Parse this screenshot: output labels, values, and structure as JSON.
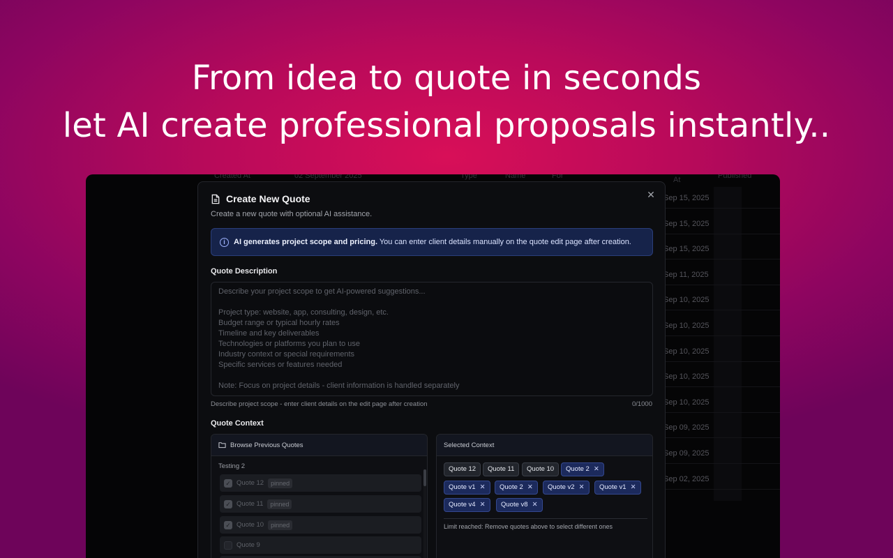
{
  "hero": {
    "line1": "From idea to quote in seconds",
    "line2": "let AI create professional proposals instantly.."
  },
  "background_table": {
    "headers": {
      "created_at": "Created At",
      "created_value": "02 September 2025",
      "type": "Type",
      "name": "Name",
      "for": "For",
      "at": "At",
      "published": "Published"
    },
    "dates": [
      "Sep 15, 2025",
      "Sep 15, 2025",
      "Sep 15, 2025",
      "Sep 11, 2025",
      "Sep 10, 2025",
      "Sep 10, 2025",
      "Sep 10, 2025",
      "Sep 10, 2025",
      "Sep 10, 2025",
      "Sep 09, 2025",
      "Sep 09, 2025",
      "Sep 02, 2025"
    ]
  },
  "modal": {
    "close": "✕",
    "title": "Create New Quote",
    "subtitle": "Create a new quote with optional AI assistance.",
    "info": {
      "icon": "i",
      "strong": "AI generates project scope and pricing.",
      "text": "You can enter client details manually on the quote edit page after creation."
    },
    "description": {
      "label": "Quote Description",
      "placeholder": "Describe your project scope to get AI-powered suggestions...\n\nProject type: website, app, consulting, design, etc.\nBudget range or typical hourly rates\nTimeline and key deliverables\nTechnologies or platforms you plan to use\nIndustry context or special requirements\nSpecific services or features needed\n\nNote: Focus on project details - client information is handled separately",
      "helper": "Describe project scope - enter client details on the edit page after creation",
      "counter": "0/1000"
    },
    "context": {
      "label": "Quote Context",
      "browse_title": "Browse Previous Quotes",
      "group": "Testing 2",
      "items": [
        {
          "name": "Quote 12",
          "tag": "pinned",
          "checked": "✓"
        },
        {
          "name": "Quote 11",
          "tag": "pinned",
          "checked": "✓"
        },
        {
          "name": "Quote 10",
          "tag": "pinned",
          "checked": "✓"
        },
        {
          "name": "Quote 9",
          "tag": "",
          "checked": ""
        }
      ],
      "selected_title": "Selected Context",
      "chips": [
        {
          "label": "Quote 12",
          "x": ""
        },
        {
          "label": "Quote 11",
          "x": ""
        },
        {
          "label": "Quote 10",
          "x": ""
        },
        {
          "label": "Quote 2",
          "x": "✕"
        },
        {
          "label": "Quote v1",
          "x": "✕"
        },
        {
          "label": "Quote 2",
          "x": "✕"
        },
        {
          "label": "Quote v2",
          "x": "✕"
        },
        {
          "label": "Quote v1",
          "x": "✕"
        },
        {
          "label": "Quote v4",
          "x": "✕"
        },
        {
          "label": "Quote v8",
          "x": "✕"
        }
      ],
      "limit_text": "Limit reached: Remove quotes above to select different ones"
    }
  },
  "colors": {
    "accent_blue": "#1c2a5c",
    "info_bg": "#16234a",
    "brand_pink": "#d80f58"
  }
}
